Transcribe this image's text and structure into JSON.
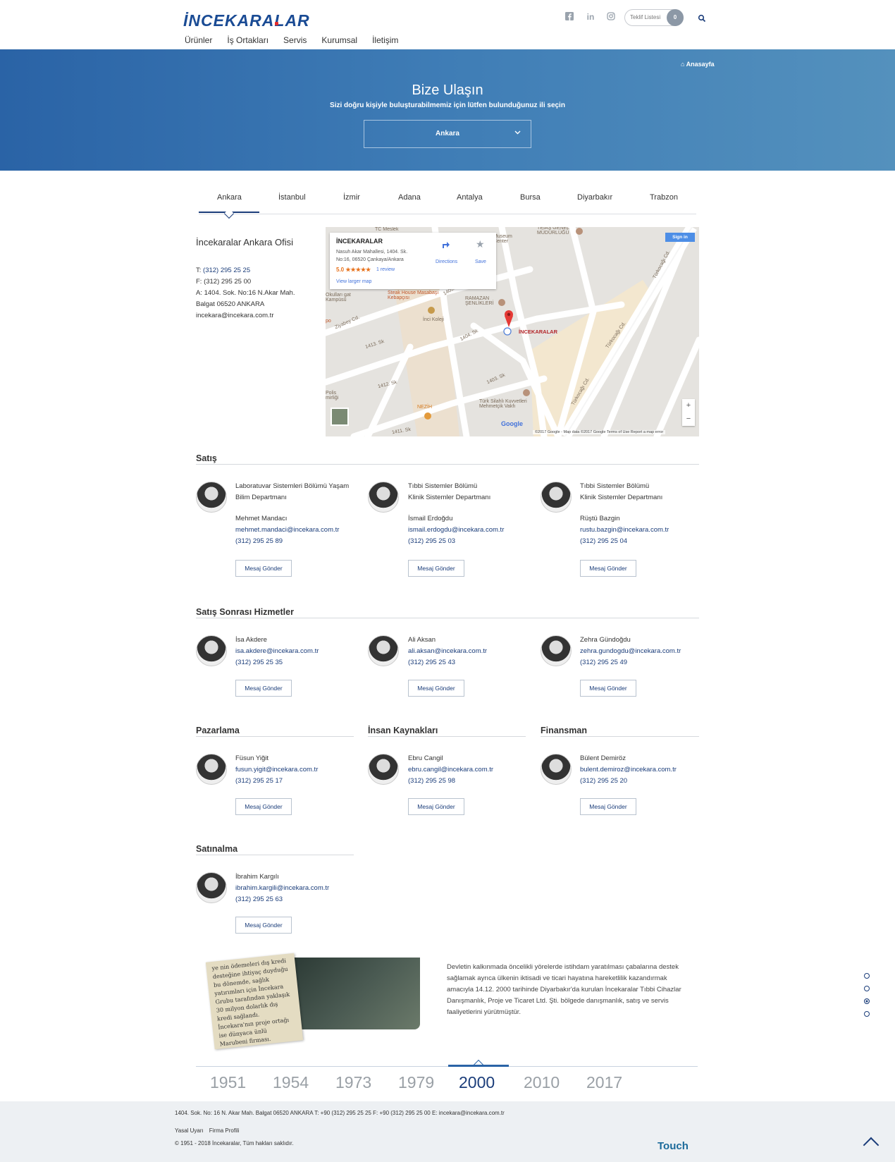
{
  "header": {
    "logo": "İNCEKARALAR",
    "nav": [
      "Ürünler",
      "İş Ortakları",
      "Servis",
      "Kurumsal",
      "İletişim"
    ],
    "social": [
      "facebook-icon",
      "linkedin-icon",
      "instagram-icon"
    ],
    "teklif_label": "Teklif Listesi",
    "teklif_count": "0"
  },
  "hero": {
    "breadcrumb": "Anasayfa",
    "title": "Bize Ulaşın",
    "subtitle": "Sizi doğru kişiyle buluşturabilmemiz için lütfen bulunduğunuz ili seçin",
    "selected_city": "Ankara"
  },
  "tabs": [
    "Ankara",
    "İstanbul",
    "İzmir",
    "Adana",
    "Antalya",
    "Bursa",
    "Diyarbakır",
    "Trabzon"
  ],
  "office": {
    "title": "İncekaralar Ankara Ofisi",
    "phone_prefix": "T: ",
    "phone": "(312) 295 25 25",
    "fax": "F: (312) 295 25 00",
    "address1": "A: 1404. Sok. No:16 N.Akar Mah.",
    "address2": "Balgat 06520 ANKARA",
    "email": "incekara@incekara.com.tr"
  },
  "map": {
    "card_title": "İNCEKARALAR",
    "card_address": "Nasuh Akar Mahallesi, 1404. Sk. No:16, 06520 Çankaya/Ankara",
    "rating": "5.0 ★★★★★",
    "reviews": "1 review",
    "larger_map": "View larger map",
    "directions": "Directions",
    "save": "Save",
    "sign_in": "Sign in",
    "pin_label": "İNCEKARALAR",
    "google": "Google",
    "footer": "©2017 Google - Map data ©2017 Google    Terms of Use    Report a map error",
    "zoom_in": "+",
    "zoom_out": "−",
    "labels": [
      "TC Meslek",
      "TEİAŞ GENEL MÜDÜRLÜĞÜ",
      "Museum Center",
      "Steak House Masabaşı Kebapçısı",
      "RAMAZAN ŞENLİKLERİ",
      "İnci Koleji",
      "Okulları gat Kampüsü",
      "Ziyabey Cd.",
      "1405. Sk",
      "1413. Sk",
      "1404. Sk",
      "1412. Sk",
      "1403. Sk",
      "Polis mirliği",
      "NEZİH",
      "Türk Silahlı Kuvvetleri Mehmetçik Vakfı",
      "Türkocağı Cd.",
      "Türkocağı Cd.",
      "Türkocağı Cd.",
      "1411. Sk",
      "po"
    ]
  },
  "sections": [
    {
      "title": "Satış",
      "people": [
        {
          "dept1": "Laboratuvar Sistemleri Bölümü Yaşam",
          "dept2": "Bilim Departmanı",
          "name": "Mehmet Mandacı",
          "email": "mehmet.mandaci@incekara.com.tr",
          "phone": "(312) 295 25 89",
          "button": "Mesaj Gönder"
        },
        {
          "dept1": "Tıbbi Sistemler Bölümü",
          "dept2": "Klinik Sistemler Departmanı",
          "name": "İsmail Erdoğdu",
          "email": "ismail.erdogdu@incekara.com.tr",
          "phone": "(312) 295 25 03",
          "button": "Mesaj Gönder"
        },
        {
          "dept1": "Tıbbi Sistemler Bölümü",
          "dept2": "Klinik Sistemler Departmanı",
          "name": "Rüştü Bazgin",
          "email": "rustu.bazgin@incekara.com.tr",
          "phone": "(312) 295 25 04",
          "button": "Mesaj Gönder"
        }
      ]
    },
    {
      "title": "Satış Sonrası Hizmetler",
      "people": [
        {
          "name": "İsa Akdere",
          "email": "isa.akdere@incekara.com.tr",
          "phone": "(312) 295 25 35",
          "button": "Mesaj Gönder"
        },
        {
          "name": "Ali Aksan",
          "email": "ali.aksan@incekara.com.tr",
          "phone": "(312) 295 25 43",
          "button": "Mesaj Gönder"
        },
        {
          "name": "Zehra Gündoğdu",
          "email": "zehra.gundogdu@incekara.com.tr",
          "phone": "(312) 295 25 49",
          "button": "Mesaj Gönder"
        }
      ]
    },
    {
      "title": "Pazarlama",
      "people": [
        {
          "name": "Füsun Yiğit",
          "email": "fusun.yigit@incekara.com.tr",
          "phone": "(312) 295 25 17",
          "button": "Mesaj Gönder"
        }
      ]
    },
    {
      "title": "İnsan Kaynakları",
      "people": [
        {
          "name": "Ebru Cangil",
          "email": "ebru.cangil@incekara.com.tr",
          "phone": "(312) 295 25 98",
          "button": "Mesaj Gönder"
        }
      ]
    },
    {
      "title": "Finansman",
      "people": [
        {
          "name": "Bülent Demiröz",
          "email": "bulent.demiroz@incekara.com.tr",
          "phone": "(312) 295 25 20",
          "button": "Mesaj Gönder"
        }
      ]
    },
    {
      "title": "Satınalma",
      "people": [
        {
          "name": "İbrahim Kargılı",
          "email": "ibrahim.kargili@incekara.com.tr",
          "phone": "(312) 295 25 63",
          "button": "Mesaj Gönder"
        }
      ]
    }
  ],
  "history": {
    "clipping": "ye nin ödemeleri dış kredi desteğine ihtiyaç duyduğu bu dönemde, sağlık yatırımları için İncekara Grubu tarafından yaklaşık 30 milyon dolarlık dış kredi sağlandı. İncekara'nın proje ortağı ise dünyaca ünlü Marubeni firması.",
    "text": "Devletin kalkınmada öncelikli yörelerde istihdam yaratılması çabalarına destek sağlamak ayrıca ülkenin iktisadi ve ticari hayatına hareketlilik kazandırmak amacıyla 14.12. 2000 tarihinde Diyarbakır'da kurulan İncekaralar Tıbbi Cihazlar Danışmanlık, Proje ve Ticaret Ltd. Şti. bölgede danışmanlık, satış ve servis faaliyetlerini yürütmüştür.",
    "years": [
      "1951",
      "1954",
      "1973",
      "1979",
      "2000",
      "2010",
      "2017"
    ],
    "active_year": "2000"
  },
  "footer": {
    "address": "1404. Sok. No: 16 N. Akar Mah. Balgat 06520 ANKARA T: +90 (312) 295 25 25 F: +90 (312) 295 25 00 E: incekara@incekara.com.tr",
    "links": [
      "Yasal Uyarı",
      "Firma Profili"
    ],
    "copyright": "© 1951 - 2018 İncekaralar, Tüm hakları saklıdır.",
    "brand": "Touch"
  }
}
